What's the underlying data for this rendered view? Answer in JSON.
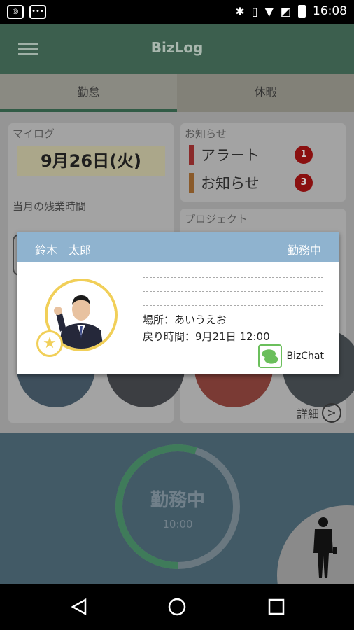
{
  "status_bar": {
    "time": "16:08",
    "left_icons": [
      "app-notification-icon",
      "more-notification-icon"
    ],
    "right_icons": [
      "bluetooth-icon",
      "vibrate-icon",
      "wifi-icon",
      "no-sim-icon",
      "battery-icon"
    ]
  },
  "app_bar": {
    "title": "BizLog",
    "menu_icon": "hamburger-menu-icon"
  },
  "tabs": [
    {
      "label": "勤怠",
      "active": true
    },
    {
      "label": "休暇",
      "active": false
    }
  ],
  "mylog": {
    "label": "マイログ",
    "date": "9月26日(火)",
    "overtime_label": "当月の残業時間"
  },
  "notices": {
    "label": "お知らせ",
    "items": [
      {
        "label": "アラート",
        "count": "1",
        "color": "#8a2020"
      },
      {
        "label": "お知らせ",
        "count": "3",
        "color": "#8a5a20"
      }
    ]
  },
  "project": {
    "label": "プロジェクト"
  },
  "detail": {
    "label": "詳細"
  },
  "status_panel": {
    "status": "勤務中",
    "time": "10:00",
    "progress": 0.55
  },
  "dialog": {
    "name": "鈴木　太郎",
    "state": "勤務中",
    "location": "場所：あいうえお",
    "return_time": "戻り時間：9月21日 12:00",
    "bizchat_label": "BizChat"
  },
  "colors": {
    "appbar": "#3c5f4e",
    "dialog_header": "#8fb3cf",
    "avatar_ring": "#f1cf58",
    "badge": "#8a1010"
  },
  "nav_icons": [
    "back-icon",
    "home-icon",
    "recents-icon"
  ]
}
